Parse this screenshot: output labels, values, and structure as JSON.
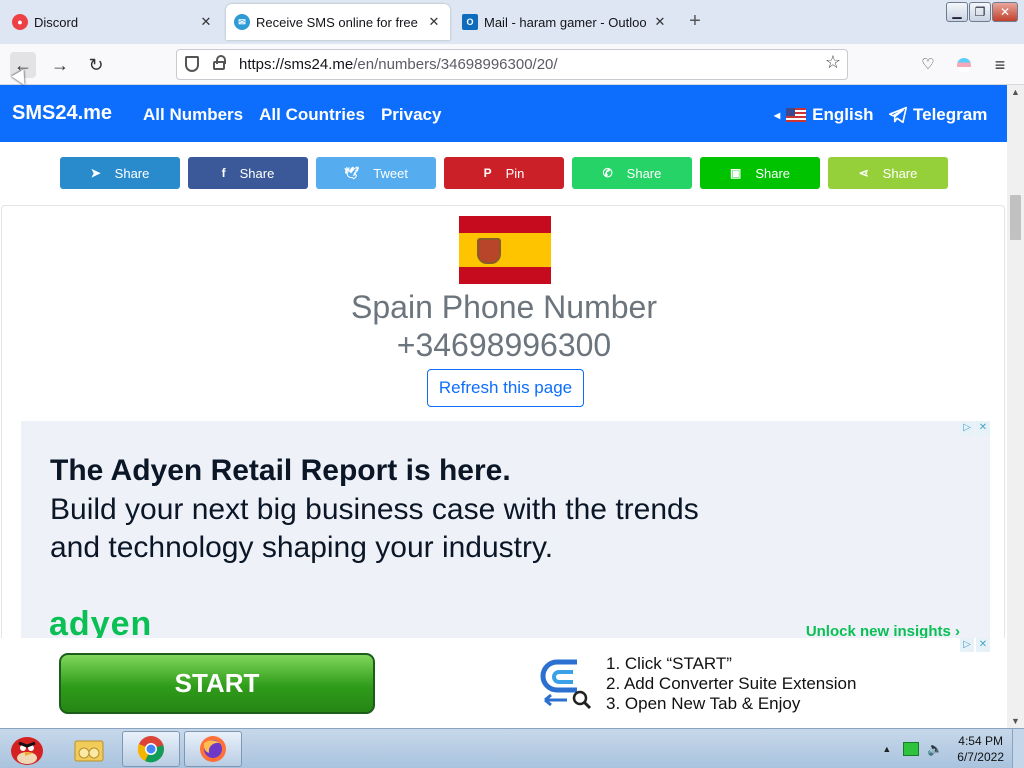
{
  "browser": {
    "tabs": [
      {
        "title": "Discord",
        "favicon": "discord-icon",
        "color": "#ed4245"
      },
      {
        "title": "Receive SMS online for free |",
        "favicon": "sms24-icon",
        "color": "#2f9bd6"
      },
      {
        "title": "Mail - haram gamer - Outloo",
        "favicon": "outlook-icon",
        "color": "#0f6cbd"
      }
    ],
    "url_host": "https://sms24.me",
    "url_path": "/en/numbers/34698996300/20/"
  },
  "site": {
    "brand": "SMS24.me",
    "nav_links": [
      "All Numbers",
      "All Countries",
      "Privacy"
    ],
    "language": "English",
    "telegram": "Telegram",
    "primary_color": "#0d6efd"
  },
  "share_buttons": [
    {
      "label": "Share",
      "icon": "telegram-icon",
      "glyph": "➤",
      "color": "#2a8bcc"
    },
    {
      "label": "Share",
      "icon": "facebook-icon",
      "glyph": "f",
      "color": "#3b5998"
    },
    {
      "label": "Tweet",
      "icon": "twitter-icon",
      "glyph": "🕊",
      "color": "#55acee"
    },
    {
      "label": "Pin",
      "icon": "pinterest-icon",
      "glyph": "P",
      "color": "#cb2027"
    },
    {
      "label": "Share",
      "icon": "whatsapp-icon",
      "glyph": "✆",
      "color": "#25d366"
    },
    {
      "label": "Share",
      "icon": "line-icon",
      "glyph": "▣",
      "color": "#00c300"
    },
    {
      "label": "Share",
      "icon": "sharethis-icon",
      "glyph": "⋖",
      "color": "#95d03a"
    }
  ],
  "number": {
    "title": "Spain Phone Number",
    "phone": "+34698996300",
    "refresh_label": "Refresh this page"
  },
  "ad": {
    "headline": "The Adyen Retail Report is here.",
    "body": "Build your next big business case with the trends and technology shaping your industry.",
    "logo": "adyen",
    "cta": "Unlock new insights ›"
  },
  "bottom_ad": {
    "button": "START",
    "steps": [
      "1. Click “START”",
      "2. Add Converter Suite Extension",
      "3. Open New Tab & Enjoy"
    ]
  },
  "taskbar": {
    "time": "4:54 PM",
    "date": "6/7/2022"
  }
}
